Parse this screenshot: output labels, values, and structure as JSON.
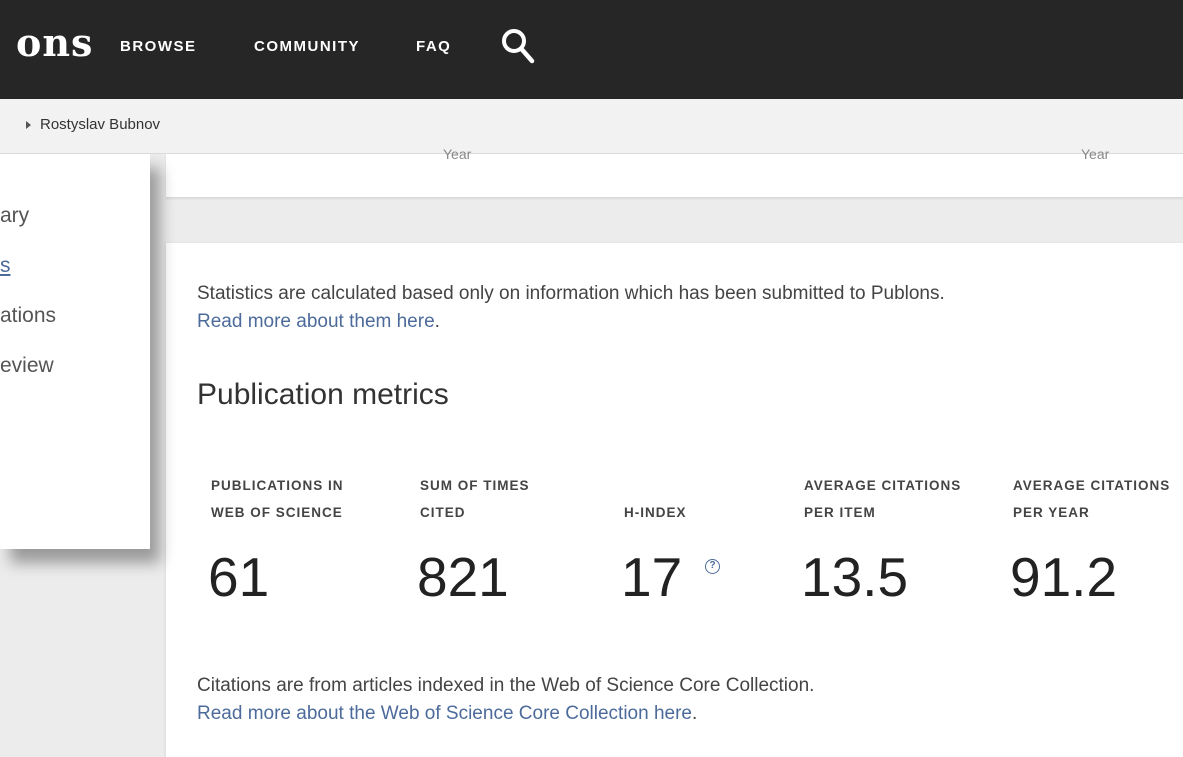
{
  "header": {
    "logo_text": "ons",
    "nav": {
      "browse": "BROWSE",
      "community": "COMMUNITY",
      "faq": "FAQ"
    },
    "colors": {
      "background": "#262626",
      "text": "#ffffff"
    }
  },
  "breadcrumb": {
    "current": "Rostyslav Bubnov"
  },
  "sidebar": {
    "items": [
      {
        "label": "ary"
      },
      {
        "label": "s",
        "active": true
      },
      {
        "label": "ations"
      },
      {
        "label": "eview"
      }
    ]
  },
  "top_card": {
    "cut_labels": [
      "Year",
      "Year"
    ]
  },
  "stats_card": {
    "intro_text": "Statistics are calculated based only on information which has been submitted to Publons.",
    "intro_link": "Read more about them here",
    "intro_link_suffix": ".",
    "section_title": "Publication metrics",
    "metrics": [
      {
        "label_line1": "PUBLICATIONS IN",
        "label_line2": "WEB OF SCIENCE",
        "value": "61"
      },
      {
        "label_line1": "SUM OF TIMES",
        "label_line2": "CITED",
        "value": "821"
      },
      {
        "label_line1": "",
        "label_line2": "H-INDEX",
        "value": "17",
        "help_icon": "question-circle-icon"
      },
      {
        "label_line1": "AVERAGE CITATIONS",
        "label_line2": "PER ITEM",
        "value": "13.5"
      },
      {
        "label_line1": "AVERAGE CITATIONS",
        "label_line2": "PER YEAR",
        "value": "91.2"
      }
    ],
    "footnote_text": "Citations are from articles indexed in the Web of Science Core Collection.",
    "footnote_link": "Read more about the Web of Science Core Collection here",
    "footnote_link_suffix": "."
  },
  "colors": {
    "link": "#4c6b9b",
    "page_background": "#ececec",
    "card_background": "#ffffff"
  }
}
